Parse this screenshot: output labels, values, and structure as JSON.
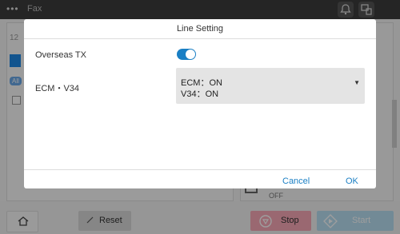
{
  "topbar": {
    "menu_glyph": "•••",
    "title": "Fax",
    "icons": [
      "bell-icon",
      "pc-icon"
    ]
  },
  "background": {
    "number_hint": "12",
    "all_tag": "All",
    "status_off": "OFF"
  },
  "dialog": {
    "title": "Line Setting",
    "overseas_tx": {
      "label": "Overseas TX",
      "enabled": true
    },
    "ecm_v34": {
      "label": "ECM・V34",
      "selected_line1": "ECM：ON",
      "selected_line2": "V34：ON"
    },
    "cancel_label": "Cancel",
    "ok_label": "OK"
  },
  "bottombar": {
    "reset_label": "Reset",
    "stop_label": "Stop",
    "start_label": "Start"
  },
  "colors": {
    "accent": "#1a7fc4",
    "stop": "#f8a9b7",
    "start": "#b9dff2"
  }
}
